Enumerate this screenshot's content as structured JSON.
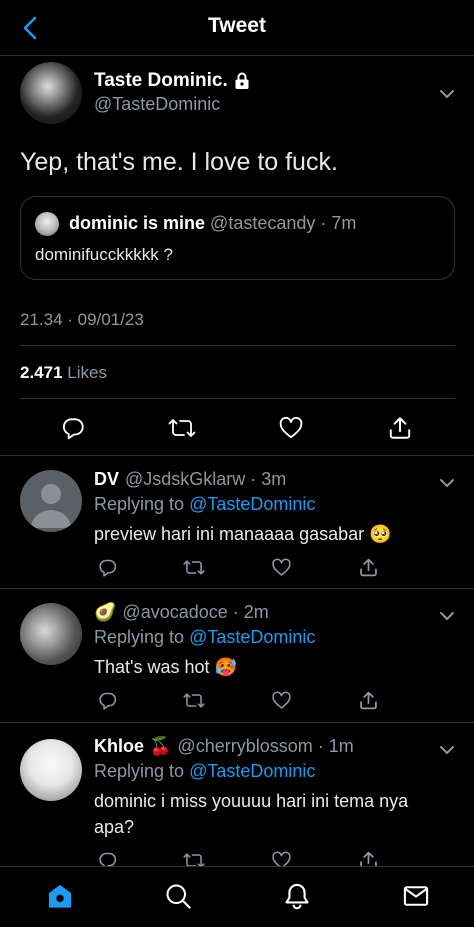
{
  "header": {
    "title": "Tweet"
  },
  "tweet": {
    "author_name": "Taste Dominic.",
    "author_handle": "@TasteDominic",
    "text": "Yep, that's me. I love to fuck.",
    "quote": {
      "name": "dominic is mine",
      "handle_time": "@tastecandy · 7m",
      "text": "dominifucckkkkk ?"
    },
    "timestamp": "21.34 · 09/01/23",
    "likes_count": "2.471",
    "likes_label": "Likes"
  },
  "replies": [
    {
      "name": "DV",
      "handle_time": "@JsdskGklarw · 3m",
      "replying_label": "Replying to",
      "replying_to": "@TasteDominic",
      "text": "preview hari ini manaaaa gasabar 🥺"
    },
    {
      "name": "🥑",
      "handle_time": "@avocadoce · 2m",
      "replying_label": "Replying to",
      "replying_to": "@TasteDominic",
      "text": "That's was hot 🥵"
    },
    {
      "name": "Khloe 🍒",
      "handle_time": "@cherryblossom · 1m",
      "replying_label": "Replying to",
      "replying_to": "@TasteDominic",
      "text": "dominic i miss youuuu hari ini tema nya apa?"
    }
  ],
  "colors": {
    "accent": "#1d9bf0",
    "muted": "#8b98a5",
    "divider": "#2f3336"
  },
  "icons": [
    "back-icon",
    "lock-icon",
    "chevron-down-icon",
    "reply-icon",
    "retweet-icon",
    "like-icon",
    "share-icon",
    "home-icon",
    "search-icon",
    "notifications-icon",
    "messages-icon"
  ]
}
